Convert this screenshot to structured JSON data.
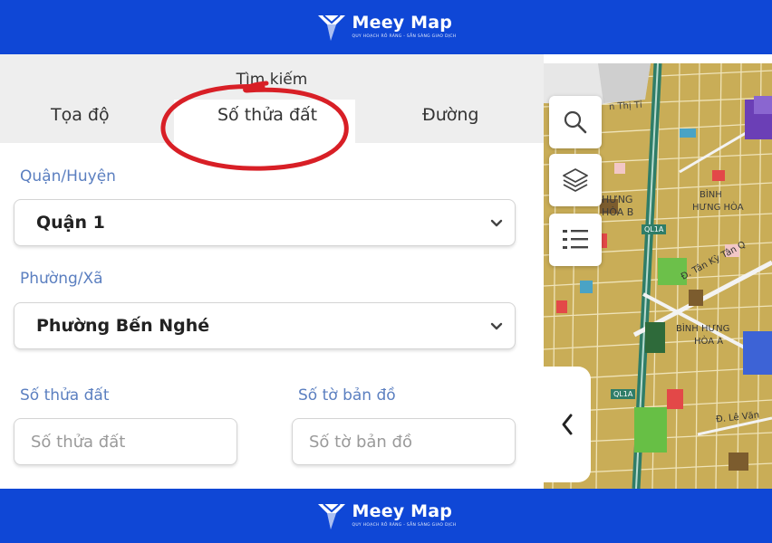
{
  "brand": {
    "name": "Meey Map",
    "tagline": "QUY HOẠCH RÕ RÀNG - SẴN SÀNG GIAO DỊCH",
    "banner_color": "#0f47d6"
  },
  "search_panel": {
    "title": "Tìm kiếm",
    "tabs": [
      {
        "label": "Tọa độ"
      },
      {
        "label": "Số thửa đất",
        "active": true
      },
      {
        "label": "Đường"
      }
    ],
    "district_label": "Quận/Huyện",
    "district_value": "Quận 1",
    "ward_label": "Phường/Xã",
    "ward_value": "Phường Bến Nghé",
    "parcel_label": "Số thửa đất",
    "parcel_placeholder": "Số thửa đất",
    "sheet_label": "Số tờ bản đồ",
    "sheet_placeholder": "Số tờ bản đồ",
    "label_color": "#5b7fc0",
    "highlight_color": "#d81f26"
  },
  "map": {
    "controls": [
      {
        "icon": "search-icon"
      },
      {
        "icon": "layers-icon"
      },
      {
        "icon": "list-icon"
      }
    ],
    "collapse_icon": "chevron-left-icon",
    "labels": {
      "street_1": "n Thị Tỉ",
      "area_1": "HƯNG",
      "area_2": "HÒA B",
      "area_3": "BÌNH",
      "area_4": "HƯNG HÒA",
      "street_2": "Đ. Tân Kỳ Tân Q",
      "area_5": "BÌNH HƯNG",
      "area_6": "HÒA A",
      "street_3": "Đ. Lê Văn",
      "road_sign_1": "QL1A",
      "road_sign_2": "QL1A"
    }
  }
}
